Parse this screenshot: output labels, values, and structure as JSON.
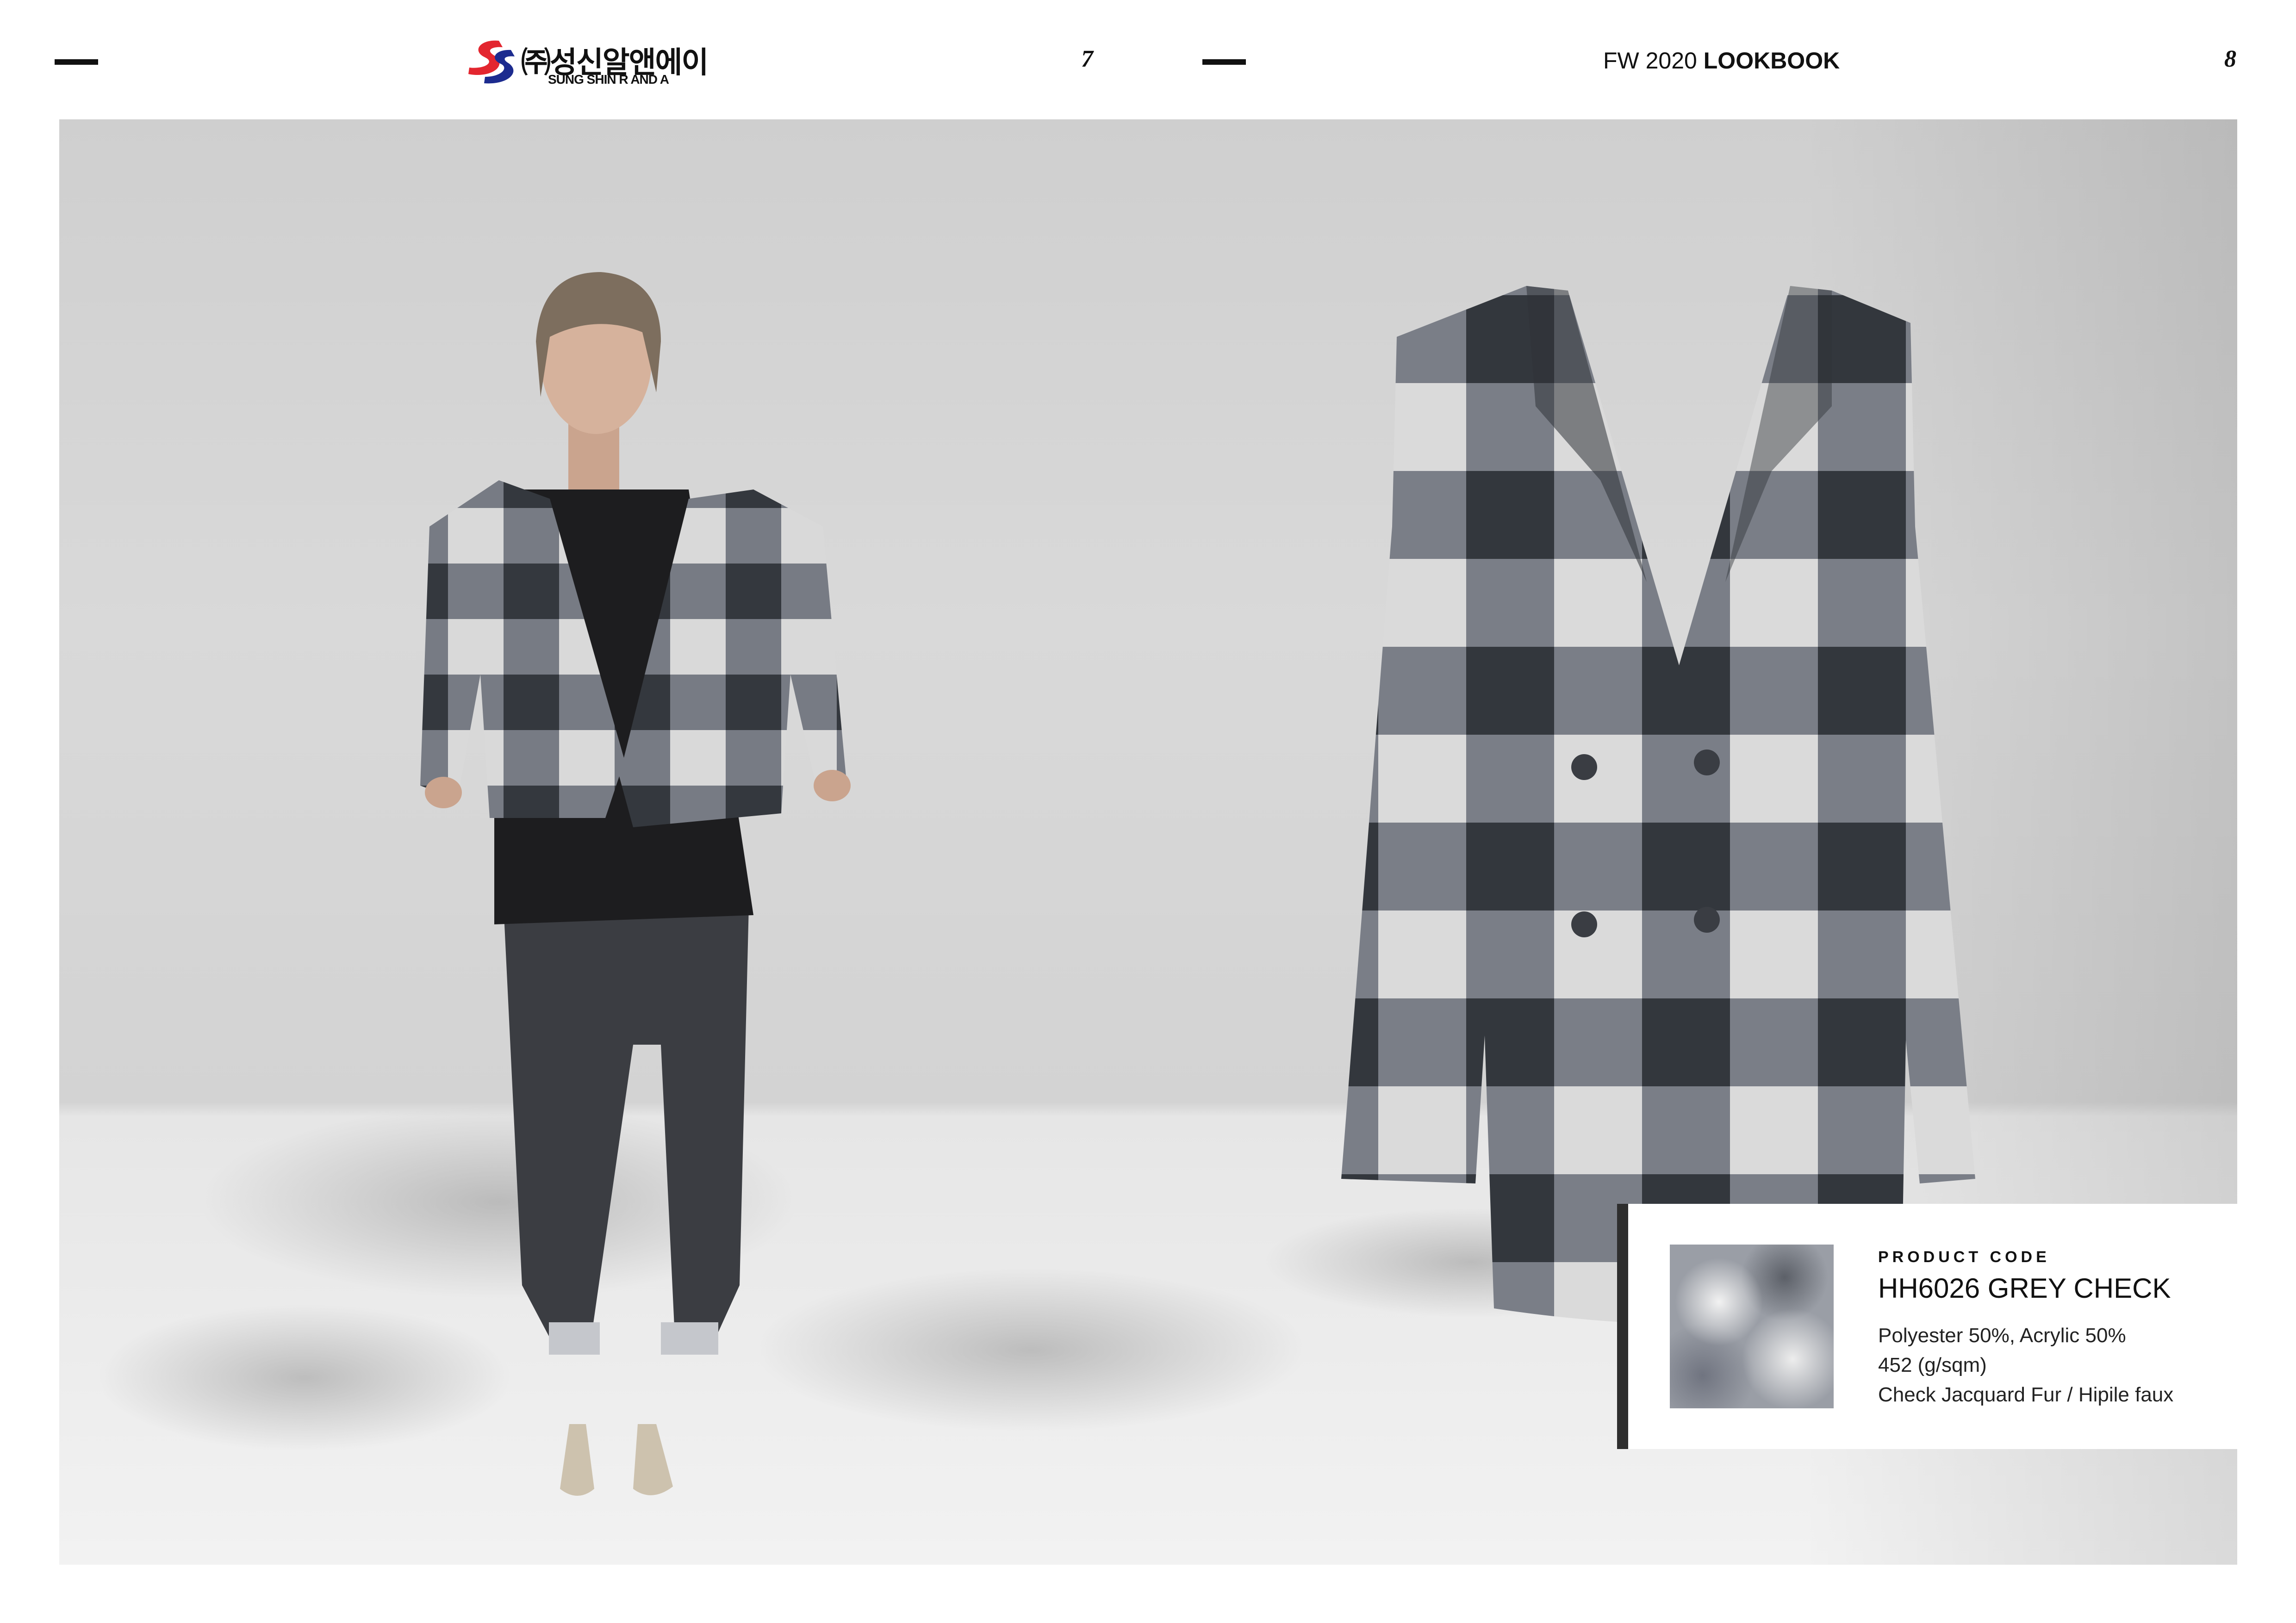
{
  "header": {
    "page_left": "7",
    "page_right": "8",
    "brand_korean": "㈜성신알앤에이",
    "brand_english": "SUNG SHIN R AND A",
    "lookbook_prefix": "FW 2020",
    "lookbook_bold": "LOOKBOOK"
  },
  "product": {
    "label": "PRODUCT CODE",
    "code": "HH6026 GREY CHECK",
    "composition": "Polyester 50%, Acrylic 50%",
    "weight": "452 (g/sqm)",
    "fabric": "Check Jacquard Fur / Hipile faux"
  },
  "colors": {
    "brand_red": "#e3262f",
    "brand_blue": "#1c2b8f",
    "check_dark": "#34383e",
    "check_mid": "#777b84",
    "check_light": "#d9d9d9",
    "card_border": "#2e2e2e"
  }
}
